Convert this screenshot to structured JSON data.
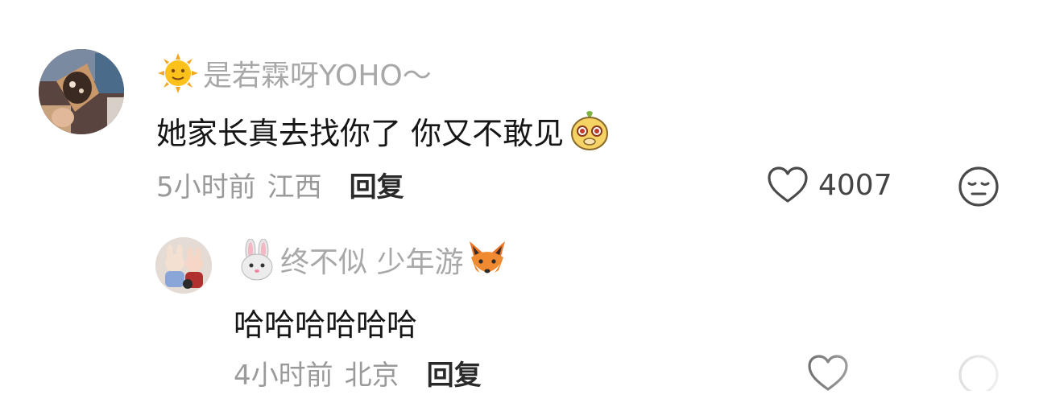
{
  "comment": {
    "username": "是若霖呀YOHO～",
    "text": "她家长真去找你了 你又不敢见",
    "time": "5小时前",
    "location": "江西",
    "reply_label": "回复",
    "like_count": "4007",
    "username_emoji_icon": "sun-face-icon",
    "text_emoji_icon": "cute-face-sticker-icon"
  },
  "reply": {
    "username": "终不似 少年游",
    "text": "哈哈哈哈哈哈",
    "time": "4小时前",
    "location": "北京",
    "reply_label": "回复",
    "username_prefix_icon": "rabbit-face-icon",
    "username_suffix_icon": "fox-face-icon"
  },
  "colors": {
    "name": "#a8a8a8",
    "text": "#161616",
    "meta": "#9a9a9a",
    "icon": "#4a4a4a"
  }
}
